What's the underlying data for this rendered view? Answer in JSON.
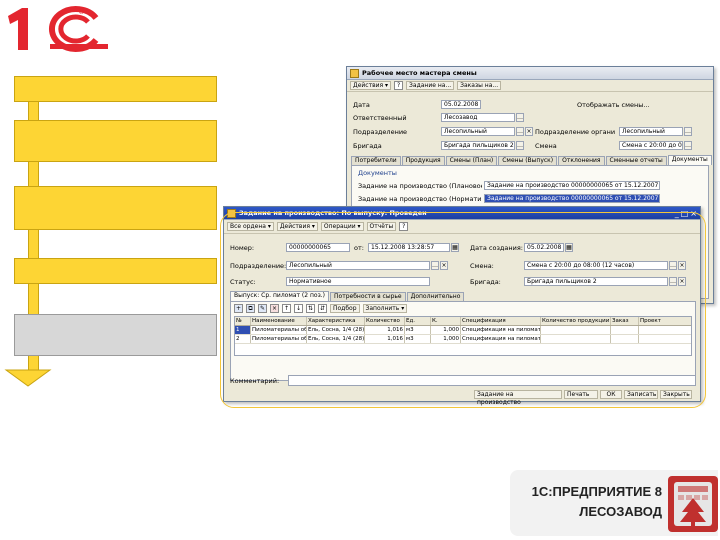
{
  "logo": {
    "text": "1С",
    "reg": "®"
  },
  "back_window": {
    "title": "Рабочее место мастера смены",
    "toolbar": [
      "Действия ▾",
      "?",
      "Задание на...",
      "Заказы на..."
    ],
    "fields": {
      "date_label": "Дата",
      "date_value": "05.02.2008",
      "responsible_label": "Ответственный",
      "responsible_value": "Лесозавод",
      "division_label": "Подразделение",
      "division_value": "Лесопильный",
      "org_division_label": "Подразделение организации",
      "org_division_value": "Лесопильный",
      "brigade_label": "Бригада",
      "brigade_value": "Бригада пильщиков 2",
      "shift_label": "Смена",
      "shift_value": "Смена с 20:00 до 08:00 (12 часов)",
      "check_label": "Отображать смены..."
    },
    "tabs": [
      "Потребители",
      "Продукция",
      "Смены (План)",
      "Смены (Выпуск)",
      "Отклонения",
      "Сменные отчеты",
      "Документы"
    ],
    "section": "Документы",
    "doc_rows": [
      {
        "label": "Задание на производство (Плановое)",
        "value": "Задание на производство 00000000065 от 15.12.2007 13:28:57"
      },
      {
        "label": "Задание на производство (Нормативное)",
        "value": "Задание на производство 00000000065 от 15.12.2007 13:28:57"
      }
    ]
  },
  "front_window": {
    "title": "Задание на производство: По выпуску. Проведен",
    "toolbar": [
      "Все ордена ▾",
      "Действия ▾",
      "Операции ▾",
      "Отчёты"
    ],
    "number_label": "Номер:",
    "number_value": "00000000065",
    "date_sep": "от:",
    "date_value": "15.12.2008 13:28:57",
    "start_label": "Дата создания:",
    "start_value": "05.02.2008",
    "division_label": "Подразделение:",
    "division_value": "Лесопильный",
    "shift_label": "Смена:",
    "shift_value": "Смена с 20:00 до 08:00 (12 часов)",
    "status_label": "Статус:",
    "status_value": "Нормативное",
    "brigade_label": "Бригада:",
    "brigade_value": "Бригада пильщиков 2",
    "tabs": [
      "Выпуск: Ср. пиломат (2 поз.)",
      "Потребности в сырье",
      "Дополнительно"
    ],
    "subtoolbar": [
      "Подбор",
      "Заполнить ▾"
    ],
    "grid_headers": [
      "№",
      "Наименование",
      "Характеристика",
      "Количество",
      "Ед.",
      "К.",
      "Спецификация",
      "Количество продукции",
      "Заказ",
      "Проект"
    ],
    "grid_rows": [
      [
        "1",
        "Пиломатериалы обрезные",
        "Ель, Сосна, 1/4 (28)",
        "1,016",
        "м3",
        "1,000",
        "Спецификация на пиломатериалы",
        "",
        "",
        ""
      ],
      [
        "2",
        "Пиломатериалы обрезные",
        "Ель, Сосна, 1/4 (28)",
        "1,016",
        "м3",
        "1,000",
        "Спецификация на пиломатериалы",
        "",
        "",
        ""
      ]
    ],
    "comment_label": "Комментарий:",
    "bottom_buttons": [
      "Задание на производство",
      "Печать",
      "ОК",
      "Записать",
      "Закрыть"
    ]
  },
  "product": {
    "line1": "1С:ПРЕДПРИЯТИЕ 8",
    "line2": "ЛЕСОЗАВОД"
  },
  "colors": {
    "brand_red": "#e3262f",
    "accent_yellow": "#fdd534",
    "badge_red": "#c0302e"
  }
}
